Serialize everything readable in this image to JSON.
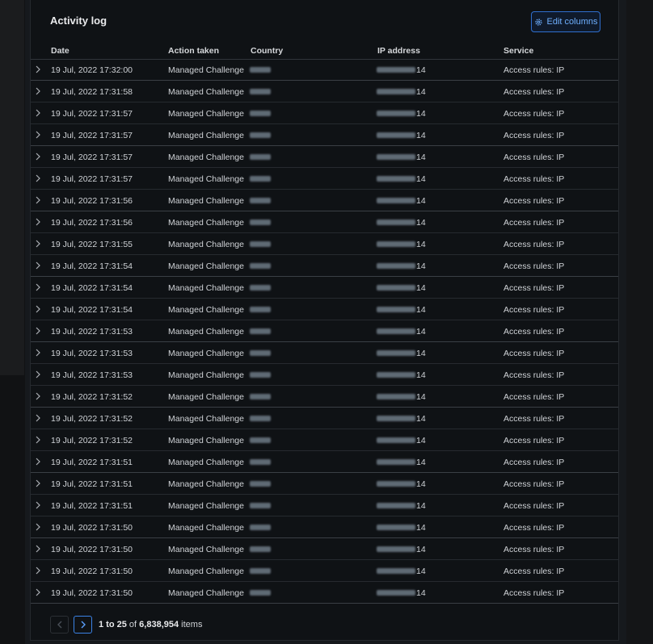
{
  "card": {
    "title": "Activity log",
    "edit_columns_label": "Edit columns"
  },
  "table": {
    "columns": [
      "Date",
      "Action taken",
      "Country",
      "IP address",
      "Service"
    ],
    "rows": [
      {
        "date": "19 Jul, 2022 17:32:00",
        "action": "Managed Challenge",
        "ip_suffix": "14",
        "service": "Access rules: IP"
      },
      {
        "date": "19 Jul, 2022 17:31:58",
        "action": "Managed Challenge",
        "ip_suffix": "14",
        "service": "Access rules: IP"
      },
      {
        "date": "19 Jul, 2022 17:31:57",
        "action": "Managed Challenge",
        "ip_suffix": "14",
        "service": "Access rules: IP"
      },
      {
        "date": "19 Jul, 2022 17:31:57",
        "action": "Managed Challenge",
        "ip_suffix": "14",
        "service": "Access rules: IP"
      },
      {
        "date": "19 Jul, 2022 17:31:57",
        "action": "Managed Challenge",
        "ip_suffix": "14",
        "service": "Access rules: IP"
      },
      {
        "date": "19 Jul, 2022 17:31:57",
        "action": "Managed Challenge",
        "ip_suffix": "14",
        "service": "Access rules: IP"
      },
      {
        "date": "19 Jul, 2022 17:31:56",
        "action": "Managed Challenge",
        "ip_suffix": "14",
        "service": "Access rules: IP"
      },
      {
        "date": "19 Jul, 2022 17:31:56",
        "action": "Managed Challenge",
        "ip_suffix": "14",
        "service": "Access rules: IP"
      },
      {
        "date": "19 Jul, 2022 17:31:55",
        "action": "Managed Challenge",
        "ip_suffix": "14",
        "service": "Access rules: IP"
      },
      {
        "date": "19 Jul, 2022 17:31:54",
        "action": "Managed Challenge",
        "ip_suffix": "14",
        "service": "Access rules: IP"
      },
      {
        "date": "19 Jul, 2022 17:31:54",
        "action": "Managed Challenge",
        "ip_suffix": "14",
        "service": "Access rules: IP"
      },
      {
        "date": "19 Jul, 2022 17:31:54",
        "action": "Managed Challenge",
        "ip_suffix": "14",
        "service": "Access rules: IP"
      },
      {
        "date": "19 Jul, 2022 17:31:53",
        "action": "Managed Challenge",
        "ip_suffix": "14",
        "service": "Access rules: IP"
      },
      {
        "date": "19 Jul, 2022 17:31:53",
        "action": "Managed Challenge",
        "ip_suffix": "14",
        "service": "Access rules: IP"
      },
      {
        "date": "19 Jul, 2022 17:31:53",
        "action": "Managed Challenge",
        "ip_suffix": "14",
        "service": "Access rules: IP"
      },
      {
        "date": "19 Jul, 2022 17:31:52",
        "action": "Managed Challenge",
        "ip_suffix": "14",
        "service": "Access rules: IP"
      },
      {
        "date": "19 Jul, 2022 17:31:52",
        "action": "Managed Challenge",
        "ip_suffix": "14",
        "service": "Access rules: IP"
      },
      {
        "date": "19 Jul, 2022 17:31:52",
        "action": "Managed Challenge",
        "ip_suffix": "14",
        "service": "Access rules: IP"
      },
      {
        "date": "19 Jul, 2022 17:31:51",
        "action": "Managed Challenge",
        "ip_suffix": "14",
        "service": "Access rules: IP"
      },
      {
        "date": "19 Jul, 2022 17:31:51",
        "action": "Managed Challenge",
        "ip_suffix": "14",
        "service": "Access rules: IP"
      },
      {
        "date": "19 Jul, 2022 17:31:51",
        "action": "Managed Challenge",
        "ip_suffix": "14",
        "service": "Access rules: IP"
      },
      {
        "date": "19 Jul, 2022 17:31:50",
        "action": "Managed Challenge",
        "ip_suffix": "14",
        "service": "Access rules: IP"
      },
      {
        "date": "19 Jul, 2022 17:31:50",
        "action": "Managed Challenge",
        "ip_suffix": "14",
        "service": "Access rules: IP"
      },
      {
        "date": "19 Jul, 2022 17:31:50",
        "action": "Managed Challenge",
        "ip_suffix": "14",
        "service": "Access rules: IP"
      },
      {
        "date": "19 Jul, 2022 17:31:50",
        "action": "Managed Challenge",
        "ip_suffix": "14",
        "service": "Access rules: IP"
      }
    ]
  },
  "pagination": {
    "range": "1 to 25",
    "of_label": "of",
    "total": "6,838,954",
    "items_label": "items"
  },
  "colors": {
    "accent": "#3b83e6",
    "card_bg": "#0f1215"
  },
  "icons": {
    "edit_columns": "gear-icon",
    "row_expand": "chevron-right-icon",
    "prev_page": "chevron-left-icon",
    "next_page": "chevron-right-icon"
  }
}
